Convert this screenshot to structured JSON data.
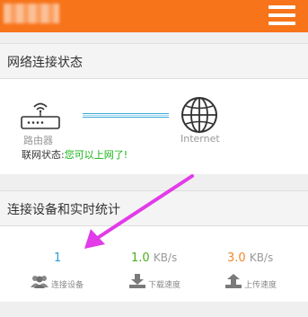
{
  "header": {
    "bg_color": "#f7741a",
    "menu_icon": "hamburger-menu-icon"
  },
  "network_status": {
    "section_title": "网络连接状态",
    "router_label": "路由器",
    "internet_label": "Internet",
    "status_label": "联网状态:",
    "status_value": "您可以上网了!",
    "status_color": "#16b316"
  },
  "devices_stats": {
    "section_title": "连接设备和实时统计",
    "connected_count": "1",
    "connected_label": "连接设备",
    "download_value": "1.0",
    "download_unit": "KB/s",
    "download_label": "下载速度",
    "upload_value": "3.0",
    "upload_unit": "KB/s",
    "upload_label": "上传速度",
    "colors": {
      "count": "#2a9ad6",
      "download": "#4caf1e",
      "upload": "#f0882a"
    }
  },
  "annotation": {
    "arrow_color": "#e23be8"
  }
}
